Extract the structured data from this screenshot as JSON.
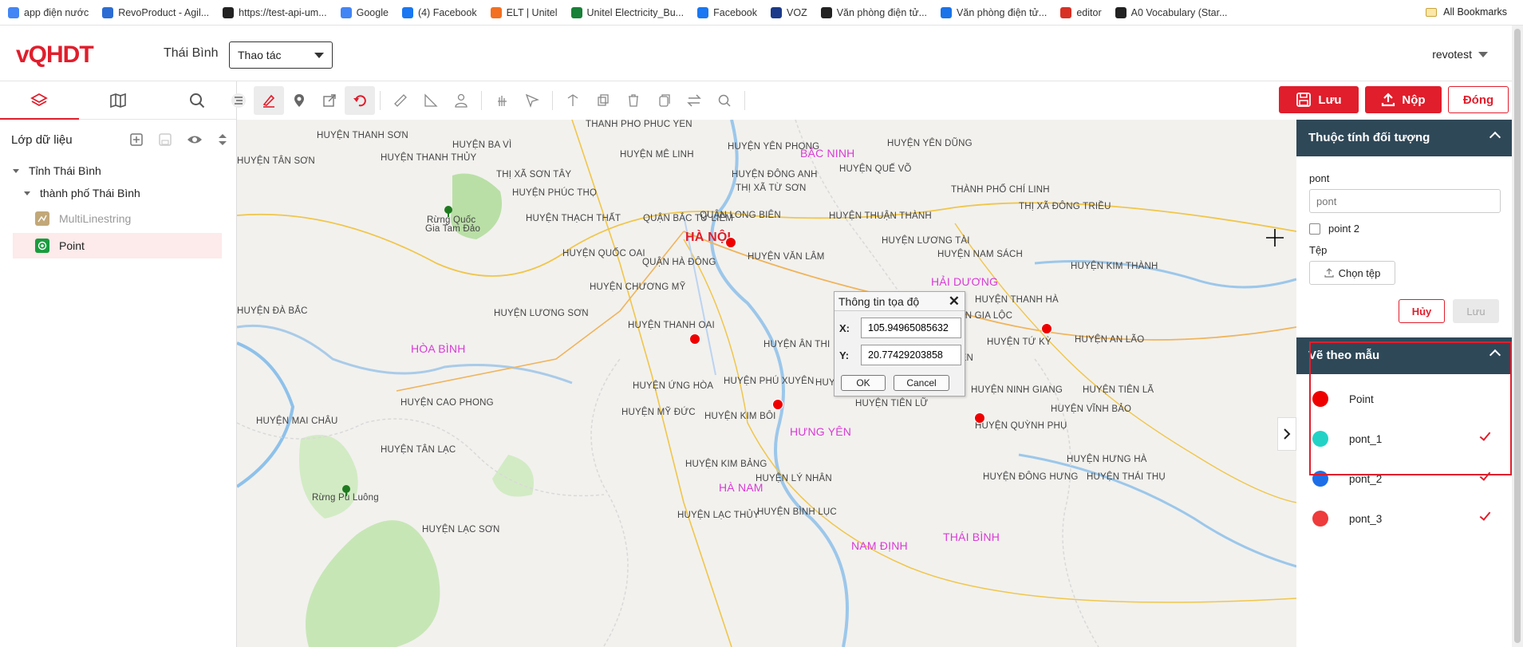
{
  "bookmarks": [
    {
      "label": "app điện nước",
      "color": "#4285f4"
    },
    {
      "label": "RevoProduct - Agil...",
      "color": "#2b6cd4"
    },
    {
      "label": "https://test-api-um...",
      "color": "#222222"
    },
    {
      "label": "Google",
      "color": "#4285f4"
    },
    {
      "label": "(4) Facebook",
      "color": "#1877f2"
    },
    {
      "label": "ELT | Unitel",
      "color": "#f36f21"
    },
    {
      "label": "Unitel Electricity_Bu...",
      "color": "#188038"
    },
    {
      "label": "Facebook",
      "color": "#1877f2"
    },
    {
      "label": "VOZ",
      "color": "#1b3a8a"
    },
    {
      "label": "Văn phòng điện tử...",
      "color": "#222222"
    },
    {
      "label": "Văn phòng điện tử...",
      "color": "#1a73e8"
    },
    {
      "label": "editor",
      "color": "#d93025"
    },
    {
      "label": "A0 Vocabulary (Star...",
      "color": "#222222"
    }
  ],
  "all_bookmarks": "All Bookmarks",
  "header": {
    "logo": "vQHDT",
    "province": "Thái Bình",
    "action_select": "Thao tác",
    "user": "revotest"
  },
  "sidebar": {
    "title": "Lớp dữ liệu",
    "tree": {
      "root": "Tỉnh Thái Bình",
      "child": "thành phố Thái Bình",
      "layers": [
        {
          "label": "MultiLinestring"
        },
        {
          "label": "Point"
        }
      ]
    }
  },
  "actions": {
    "save": "Lưu",
    "submit": "Nộp",
    "close": "Đóng"
  },
  "map": {
    "places": [
      {
        "t": "THÀNH PHỐ PHÚC YÊN"
      },
      {
        "t": "HUYỆN THANH SƠN"
      },
      {
        "t": "HUYỆN BA VÌ"
      },
      {
        "t": "HUYỆN MÊ LINH"
      },
      {
        "t": "HUYỆN YÊN PHONG"
      },
      {
        "t": "BẮC NINH"
      },
      {
        "t": "HUYỆN YÊN DŨNG"
      },
      {
        "t": "HUYỆN TÂN SƠN"
      },
      {
        "t": "HUYỆN THANH THỦY"
      },
      {
        "t": "HUYỆN ĐÔNG ANH"
      },
      {
        "t": "HUYỆN QUẾ VÕ"
      },
      {
        "t": "THỊ XÃ SƠN TÂY"
      },
      {
        "t": "THỊ XÃ TỪ SƠN"
      },
      {
        "t": "HUYỆN PHÚC THỌ"
      },
      {
        "t": "THÀNH PHỐ CHÍ LINH"
      },
      {
        "t": "Rừng Quốc"
      },
      {
        "t": "Gia Tam Đảo"
      },
      {
        "t": "HUYỆN THẠCH THẤT"
      },
      {
        "t": "QUẬN BẮC TỪ LIÊM"
      },
      {
        "t": "QUẬN LONG BIÊN"
      },
      {
        "t": "HUYỆN THUẬN THÀNH"
      },
      {
        "t": "THỊ XÃ ĐÔNG TRIỀU"
      },
      {
        "t": "HÀ NỘI"
      },
      {
        "t": "HUYỆN LƯƠNG TÀI"
      },
      {
        "t": "HUYỆN QUỐC OAI"
      },
      {
        "t": "QUẬN HÀ ĐÔNG"
      },
      {
        "t": "HUYỆN VĂN LÂM"
      },
      {
        "t": "HUYỆN NAM SÁCH"
      },
      {
        "t": "HUYỆN KIM THÀNH"
      },
      {
        "t": "HUYỆN CHƯƠNG MỸ"
      },
      {
        "t": "HẢI DƯƠNG"
      },
      {
        "t": "HUYỆN ĐÀ BẮC"
      },
      {
        "t": "HUYỆN THANH HÀ"
      },
      {
        "t": "HUYỆN LƯƠNG SƠN"
      },
      {
        "t": "HUYỆN GIA LỘC"
      },
      {
        "t": "HUYỆN THANH OAI"
      },
      {
        "t": "HÒA BÌNH"
      },
      {
        "t": "HUYỆN ÂN THI"
      },
      {
        "t": "HUYỆN TỨ KỲ"
      },
      {
        "t": "HUYỆN AN LÃO"
      },
      {
        "t": "HUYỆN THANH MIỆN"
      },
      {
        "t": "HUYỆN PHÚ XUYÊN"
      },
      {
        "t": "HUYỆN ỨNG HÒA"
      },
      {
        "t": "HUYỆN KIM ĐỘNG"
      },
      {
        "t": "HUYỆN NINH GIANG"
      },
      {
        "t": "HUYỆN TIÊN LÃ"
      },
      {
        "t": "HUYỆN CAO PHONG"
      },
      {
        "t": "HUYỆN TIÊN LỮ"
      },
      {
        "t": "HUYỆN VĨNH BẢO"
      },
      {
        "t": "HUYỆN MỸ ĐỨC"
      },
      {
        "t": "HUYỆN KIM BÔI"
      },
      {
        "t": "HUYỆN MAI CHÂU"
      },
      {
        "t": "HƯNG YÊN"
      },
      {
        "t": "HUYỆN QUỲNH PHỤ"
      },
      {
        "t": "HUYỆN TÂN LẠC"
      },
      {
        "t": "HUYỆN KIM BẢNG"
      },
      {
        "t": "HUYỆN HƯNG HÀ"
      },
      {
        "t": "HÀ NAM"
      },
      {
        "t": "HUYỆN LÝ NHÂN"
      },
      {
        "t": "HUYỆN ĐÔNG HƯNG"
      },
      {
        "t": "HUYỆN THÁI THỤ"
      },
      {
        "t": "Rừng Pù Luông"
      },
      {
        "t": "HUYỆN LẠC THỦY"
      },
      {
        "t": "HUYỆN BÌNH LỤC"
      },
      {
        "t": "HUYỆN LẠC SƠN"
      },
      {
        "t": "NAM ĐỊNH"
      },
      {
        "t": "THÁI BÌNH"
      }
    ]
  },
  "coord_dialog": {
    "title": "Thông tin tọa độ",
    "x_label": "X:",
    "x_value": "105.94965085632",
    "y_label": "Y:",
    "y_value": "20.77429203858",
    "ok": "OK",
    "cancel": "Cancel"
  },
  "properties": {
    "title": "Thuộc tính đối tượng",
    "field_label": "pont",
    "field_placeholder": "pont",
    "checkbox_label": "point 2",
    "file_label": "Tệp",
    "file_button": "Chọn tệp",
    "cancel": "Hủy",
    "save": "Lưu"
  },
  "template_section": {
    "title": "Vẽ theo mẫu",
    "items": [
      {
        "label": "Point",
        "color": "#ee0000",
        "checked": false
      },
      {
        "label": "pont_1",
        "color": "#22d3c5",
        "checked": true
      },
      {
        "label": "pont_2",
        "color": "#1e6ee8",
        "checked": true
      },
      {
        "label": "pont_3",
        "color": "#ee3b3b",
        "checked": true
      }
    ]
  }
}
